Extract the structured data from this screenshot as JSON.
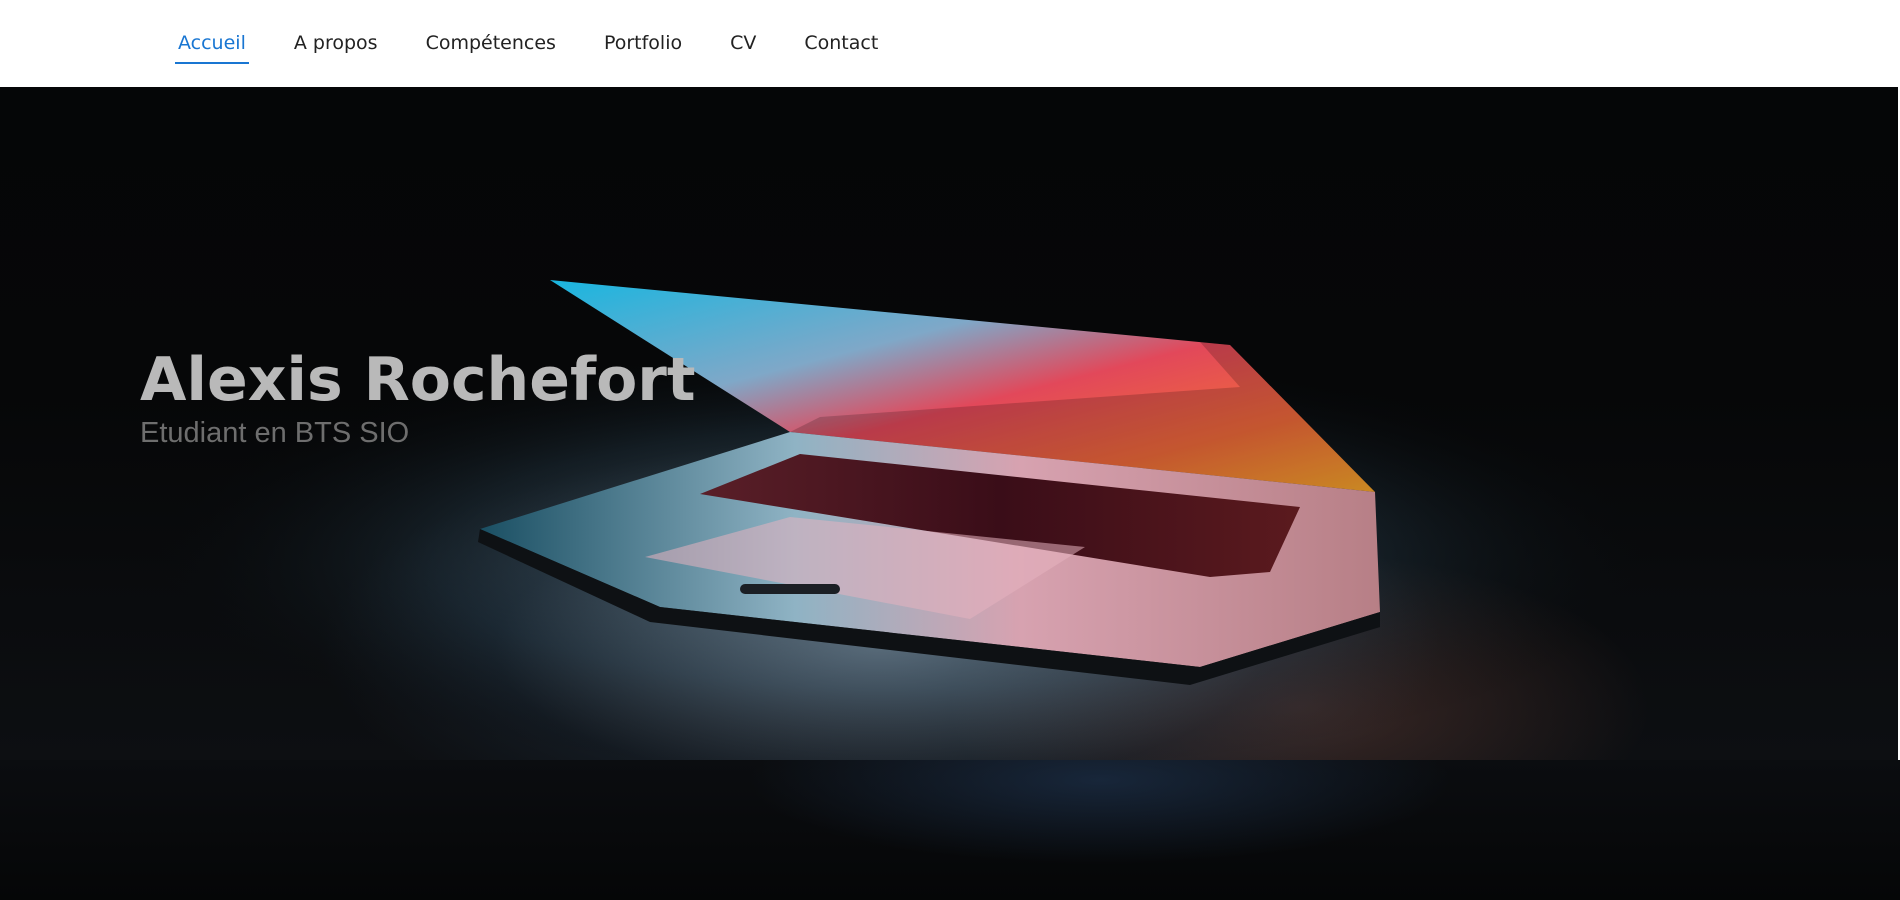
{
  "nav": {
    "items": [
      {
        "label": "Accueil",
        "active": true
      },
      {
        "label": "A propos",
        "active": false
      },
      {
        "label": "Compétences",
        "active": false
      },
      {
        "label": "Portfolio",
        "active": false
      },
      {
        "label": "CV",
        "active": false
      },
      {
        "label": "Contact",
        "active": false
      }
    ]
  },
  "hero": {
    "name": "Alexis Rochefort",
    "subtitle": "Etudiant en BTS SIO",
    "background_image": "laptop-half-open-image"
  },
  "colors": {
    "accent": "#1976d2",
    "nav_text": "#222222",
    "hero_name": "#b9b9b9",
    "hero_subtitle": "#6e6e6e"
  }
}
